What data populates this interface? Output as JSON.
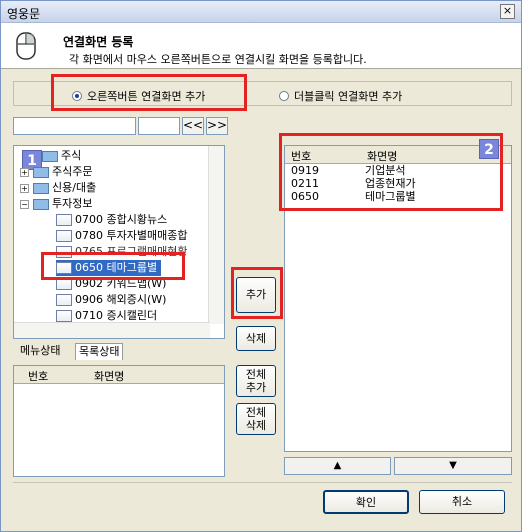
{
  "window": {
    "title": "영웅문",
    "close": "×"
  },
  "header": {
    "title": "연결화면 등록",
    "description": "각 화면에서 마우스 오른쪽버튼으로 연결시킬 화면을 등록합니다."
  },
  "radio": {
    "option1": "오른쪽버튼 연결화면 추가",
    "option2": "더블클릭 연결화면 추가",
    "selected": "option1"
  },
  "search": {
    "value": "",
    "value2": ""
  },
  "nav": {
    "prev": "<<",
    "next": ">>"
  },
  "tree": {
    "badge": "1",
    "items": [
      {
        "label": "주식"
      },
      {
        "label": "주식주문"
      },
      {
        "label": "신용/대출"
      },
      {
        "label": "투자정보"
      },
      {
        "label": "0700 종합시황뉴스"
      },
      {
        "label": "0780 투자자별매매종합"
      },
      {
        "label": "0765 프로그램매매현황"
      },
      {
        "label": "0650 테마그룹별"
      },
      {
        "label": "0902 키워드맵(W)"
      },
      {
        "label": "0906 해외증시(W)"
      },
      {
        "label": "0710 증시캘린더"
      }
    ]
  },
  "tabs": {
    "menu": "메뉴상태",
    "list": "목록상태"
  },
  "left_list": {
    "col_no": "번호",
    "col_name": "화면명"
  },
  "buttons": {
    "add": "추가",
    "delete": "삭제",
    "add_all": "전체\n추가",
    "delete_all": "전체\n삭제",
    "ok": "확인",
    "cancel": "취소"
  },
  "right_list": {
    "badge": "2",
    "col_no": "번호",
    "col_name": "화면명",
    "rows": [
      {
        "no": "0919",
        "name": "기업분석"
      },
      {
        "no": "0211",
        "name": "업종현재가"
      },
      {
        "no": "0650",
        "name": "테마그룹별"
      }
    ]
  },
  "arrows": {
    "up": "▲",
    "down": "▼"
  }
}
